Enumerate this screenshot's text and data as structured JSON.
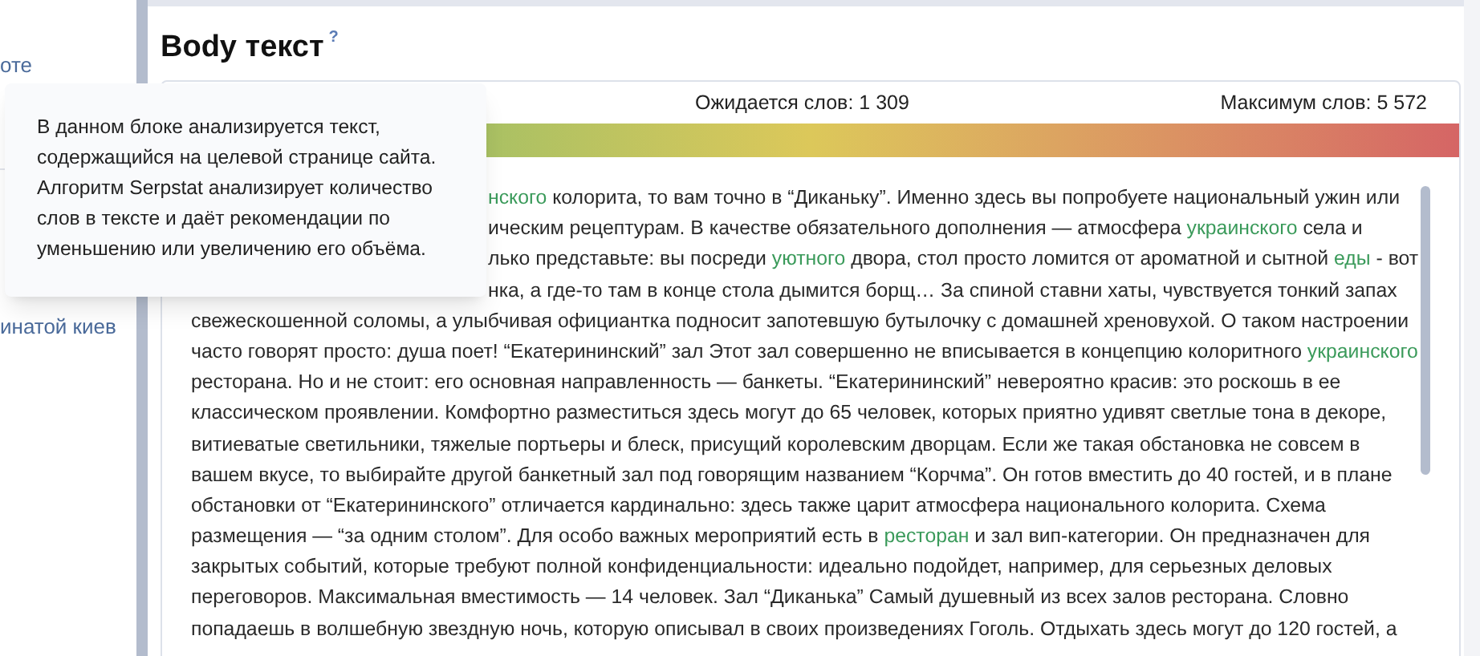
{
  "sidebar": {
    "items": [
      "оте",
      "инатой киев"
    ]
  },
  "section": {
    "title": "Body текст",
    "help": "?"
  },
  "tooltip": {
    "text": "В данном блоке анализируется текст, содержащийся на целевой странице сайта. Алгоритм Serpstat анализирует количество слов в тексте и даёт рекомендации по уменьшению или увеличению его объёма."
  },
  "stats": {
    "expected": "Ожидается слов: 1 309",
    "maximum": "Максимум слов: 5 572"
  },
  "text_lines": [
    {
      "covered": true,
      "segments": [
        {
          "text": "нского",
          "highlighted": true
        },
        {
          "text": " колорита, то вам точно в “Диканьку”. Именно здесь вы попробуете национальный ужин или",
          "highlighted": false
        }
      ]
    },
    {
      "covered": true,
      "segments": [
        {
          "text": "ическим рецептурам. В качестве обязательного дополнения — атмосфера ",
          "highlighted": false
        },
        {
          "text": "украинского",
          "highlighted": true
        },
        {
          "text": " села и",
          "highlighted": false
        }
      ]
    },
    {
      "covered": true,
      "segments": [
        {
          "text": "лько представьте: вы посреди ",
          "highlighted": false
        },
        {
          "text": "уютного",
          "highlighted": true
        },
        {
          "text": " двора, стол просто ломится от ароматной и сытной ",
          "highlighted": false
        },
        {
          "text": "еды",
          "highlighted": true
        },
        {
          "text": " - вот",
          "highlighted": false
        }
      ]
    },
    {
      "covered": true,
      "segments": [
        {
          "text": "нка, а где-то там в конце стола дымится борщ… За спиной ставни хаты, чувствуется тонкий запах",
          "highlighted": false
        }
      ]
    },
    {
      "covered": false,
      "segments": [
        {
          "text": "свежескошенной соломы, а улыбчивая официантка подносит запотевшую бутылочку с домашней хреновухой. О таком настроении",
          "highlighted": false
        }
      ]
    },
    {
      "covered": false,
      "segments": [
        {
          "text": "часто говорят просто: душа поет! “Екатерининский” зал Этот зал совершенно не вписывается в концепцию колоритного ",
          "highlighted": false
        },
        {
          "text": "украинского",
          "highlighted": true
        }
      ]
    },
    {
      "covered": false,
      "segments": [
        {
          "text": "ресторана. Но и не стоит: его основная направленность — банкеты. “Екатерининский” невероятно красив: это роскошь в ее",
          "highlighted": false
        }
      ]
    },
    {
      "covered": false,
      "segments": [
        {
          "text": "классическом проявлении. Комфортно разместиться здесь могут до 65 человек, которых приятно удивят светлые тона в декоре,",
          "highlighted": false
        }
      ]
    },
    {
      "covered": false,
      "segments": [
        {
          "text": "витиеватые светильники, тяжелые портьеры и блеск, присущий королевским дворцам. Если же такая обстановка не совсем в",
          "highlighted": false
        }
      ]
    },
    {
      "covered": false,
      "segments": [
        {
          "text": "вашем вкусе, то выбирайте другой банкетный зал под говорящим названием “Корчма”. Он готов вместить до 40 гостей, и в плане",
          "highlighted": false
        }
      ]
    },
    {
      "covered": false,
      "segments": [
        {
          "text": "обстановки от “Екатерининского” отличается кардинально: здесь также царит атмосфера национального колорита. Схема",
          "highlighted": false
        }
      ]
    },
    {
      "covered": false,
      "segments": [
        {
          "text": "размещения — “за одним столом”. Для особо важных мероприятий есть в ",
          "highlighted": false
        },
        {
          "text": "ресторан",
          "highlighted": true
        },
        {
          "text": " и зал вип-категории. Он предназначен для",
          "highlighted": false
        }
      ]
    },
    {
      "covered": false,
      "segments": [
        {
          "text": "закрытых событий, которые требуют полной конфиденциальности: идеально подойдет, например, для серьезных деловых",
          "highlighted": false
        }
      ]
    },
    {
      "covered": false,
      "segments": [
        {
          "text": "переговоров. Максимальная вместимость — 14 человек. Зал “Диканька” Самый душевный из всех залов ресторана. Словно",
          "highlighted": false
        }
      ]
    },
    {
      "covered": false,
      "segments": [
        {
          "text": "попадаешь в волшебную звездную ночь, которую описывал в своих произведениях Гоголь. Отдыхать здесь могут до 120 гостей, а",
          "highlighted": false
        }
      ]
    }
  ]
}
